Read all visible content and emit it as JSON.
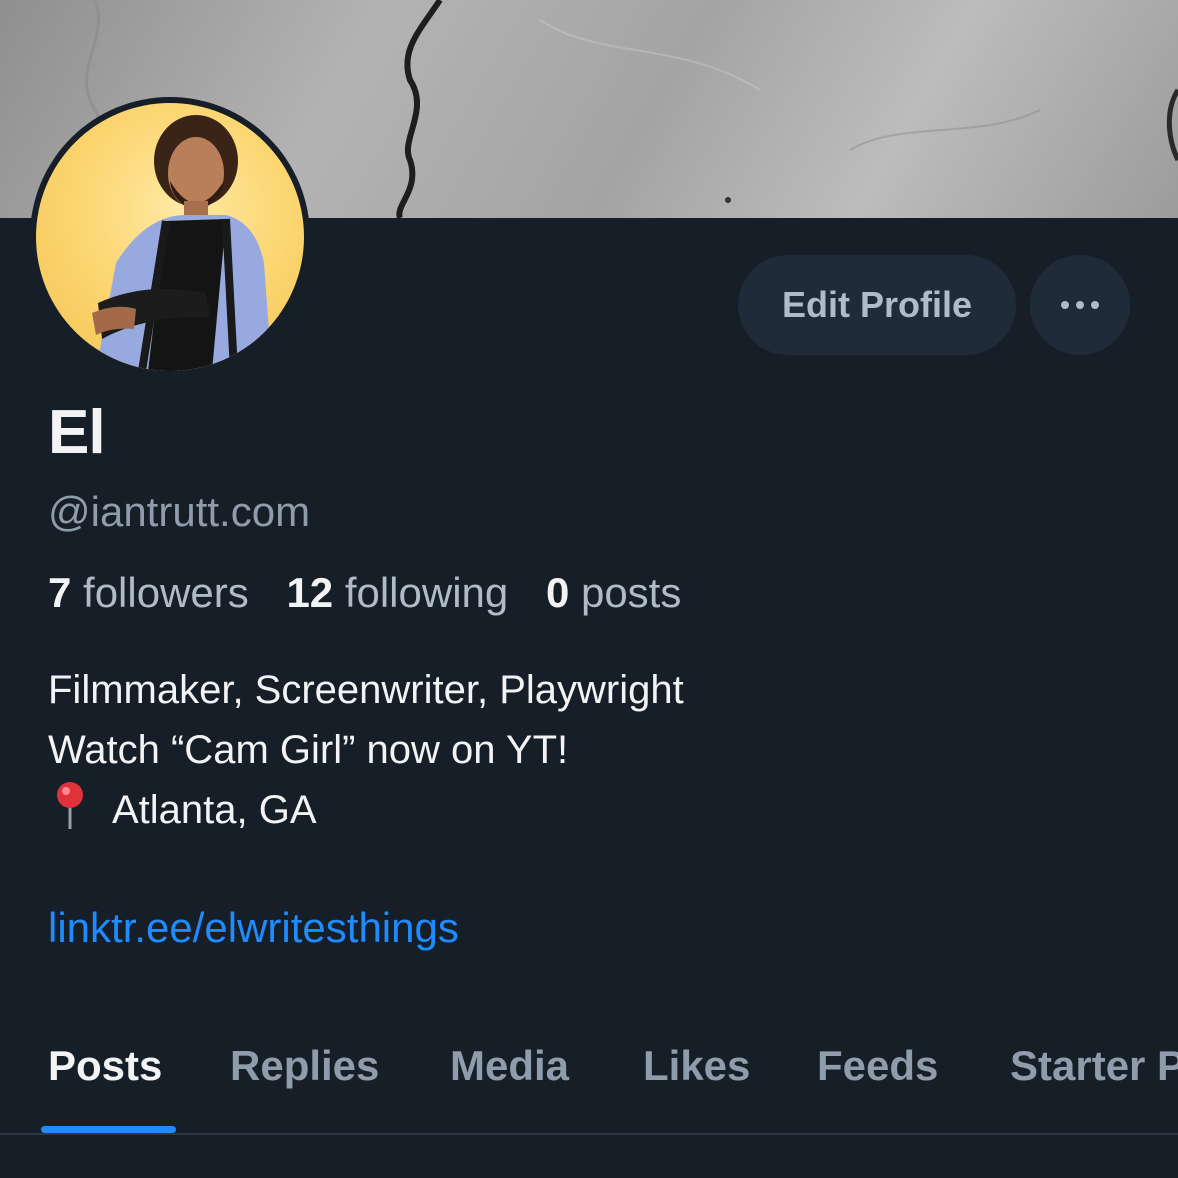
{
  "profile": {
    "display_name": "El",
    "handle": "@iantrutt.com",
    "edit_label": "Edit Profile",
    "stats": [
      {
        "count": "7",
        "label": "followers"
      },
      {
        "count": "12",
        "label": "following"
      },
      {
        "count": "0",
        "label": "posts"
      }
    ],
    "bio_lines": [
      "Filmmaker, Screenwriter, Playwright",
      "Watch “Cam Girl” now on YT!",
      "Atlanta, GA"
    ],
    "link": "linktr.ee/elwritesthings"
  },
  "tabs": [
    "Posts",
    "Replies",
    "Media",
    "Likes",
    "Feeds",
    "Starter Packs"
  ],
  "active_tab": "Posts",
  "icons": {
    "more": "more-horizontal-icon",
    "location": "round-pushpin-icon"
  },
  "colors": {
    "background": "#161e27",
    "button": "#1f2b38",
    "accent": "#208bfe",
    "muted_text": "#8e9cab",
    "primary_text": "#f1f3f5"
  }
}
